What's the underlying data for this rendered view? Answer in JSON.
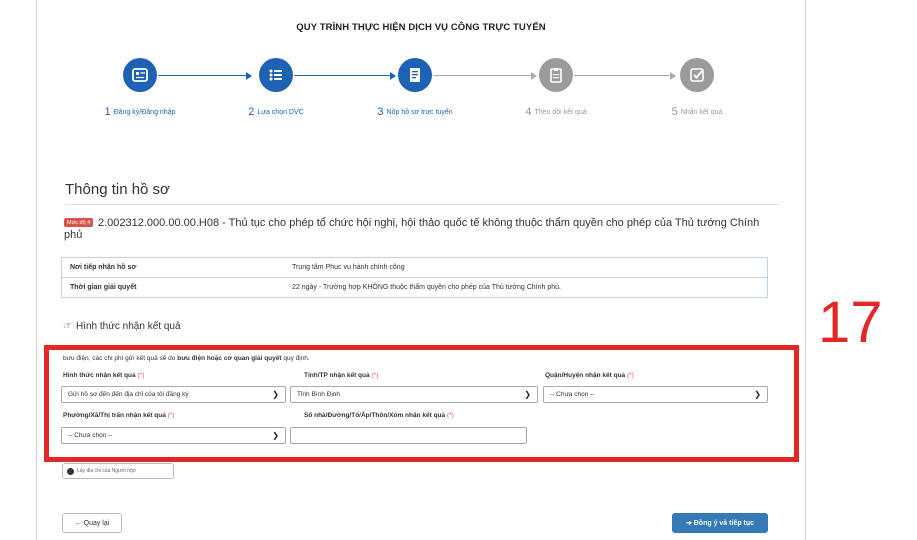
{
  "page_title": "QUY TRÌNH THỰC HIỆN DỊCH VỤ CÔNG TRỰC TUYẾN",
  "steps": [
    {
      "num": "1",
      "label": "Đăng ký/Đăng nhập",
      "icon": "id-card-icon",
      "state": "active"
    },
    {
      "num": "2",
      "label": "Lựa chọn DVC",
      "icon": "list-icon",
      "state": "active"
    },
    {
      "num": "3",
      "label": "Nộp hồ sơ trực tuyến",
      "icon": "document-upload-icon",
      "state": "active"
    },
    {
      "num": "4",
      "label": "Theo dõi kết quả",
      "icon": "clipboard-icon",
      "state": "inactive"
    },
    {
      "num": "5",
      "label": "Nhận kết quả",
      "icon": "check-icon",
      "state": "inactive"
    }
  ],
  "section_title": "Thông tin hồ sơ",
  "procedure": {
    "badge": "Mức độ 4",
    "title": "2.002312.000.00.00.H08 - Thủ tục cho phép tổ chức hội nghị, hội thảo quốc tế không thuộc thẩm quyền cho phép của Thủ tướng Chính phủ"
  },
  "info_table": [
    {
      "key": "Nơi tiếp nhận hồ sơ",
      "value": "Trung tâm Phục vụ hành chính công"
    },
    {
      "key": "Thời gian giải quyết",
      "value": "22 ngày - Trường hợp KHÔNG thuộc thẩm quyền cho phép của Thủ tướng Chính phủ."
    }
  ],
  "result_section": {
    "title": "Hình thức nhận kết quả",
    "note_prefix": "bưu điện, các chi phí gửi kết quả sẽ do ",
    "note_bold": "bưu điện hoặc cơ quan giải quyết",
    "note_suffix": " quy định.",
    "required_mark": "(*)",
    "fields": {
      "method": {
        "label": "Hình thức nhận kết quả",
        "value": "Gửi hồ sơ đến đến địa chỉ của tôi đăng ký"
      },
      "province": {
        "label": "Tỉnh/TP nhận kết quả",
        "value": "Tỉnh Bình Định"
      },
      "district": {
        "label": "Quận/Huyện nhận kết quả",
        "value": "-- Chưa chọn --"
      },
      "ward": {
        "label": "Phường/Xã/Thị trấn nhận kết quả",
        "value": "-- Chưa chọn --"
      },
      "address": {
        "label": "Số nhà/Đường/Tổ/Ấp/Thôn/Xóm nhận kết quả",
        "value": ""
      }
    },
    "address_button": "Lấy địa chỉ của Người nộp"
  },
  "annotation_number": "17",
  "buttons": {
    "back": "← Quay lại",
    "next": "➔ Đồng ý và tiếp tục"
  },
  "colors": {
    "accent": "#1e62b4",
    "highlight": "#e32626",
    "primary_button": "#337ab7"
  }
}
